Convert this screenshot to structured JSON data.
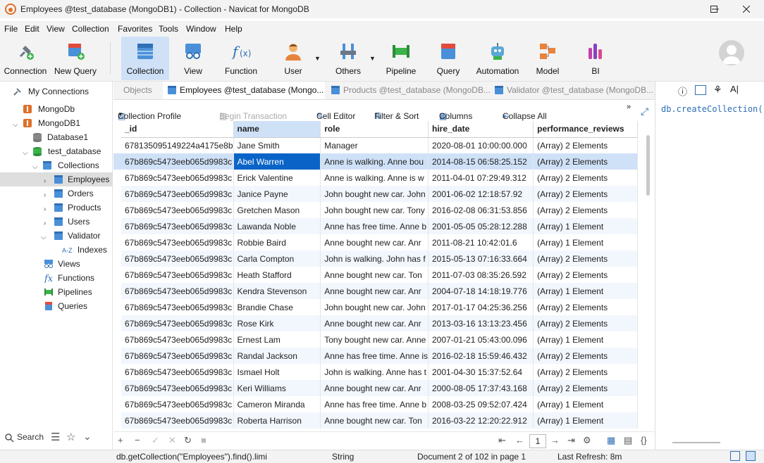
{
  "window": {
    "title": "Employees @test_database (MongoDB1) - Collection - Navicat for MongoDB",
    "min_icon": "minimize-icon",
    "max_icon": "maximize-icon",
    "close_icon": "close-icon"
  },
  "menu": [
    "File",
    "Edit",
    "View",
    "Collection",
    "Favorites",
    "Tools",
    "Window",
    "Help"
  ],
  "toolbar": {
    "connection": "Connection",
    "new_query": "New Query",
    "collection": "Collection",
    "view": "View",
    "function": "Function",
    "user": "User",
    "others": "Others",
    "pipeline": "Pipeline",
    "query": "Query",
    "automation": "Automation",
    "model": "Model",
    "bi": "BI"
  },
  "sidebar": {
    "header": "My Connections",
    "items": {
      "mongodb": "MongoDb",
      "mongodb1": "MongoDB1",
      "database1": "Database1",
      "test_database": "test_database",
      "collections": "Collections",
      "employees": "Employees",
      "orders": "Orders",
      "products": "Products",
      "users": "Users",
      "validator": "Validator",
      "indexes": "Indexes",
      "az": "A-Z",
      "views": "Views",
      "functions": "Functions",
      "pipelines": "Pipelines",
      "queries": "Queries"
    },
    "search": "Search"
  },
  "tabs": [
    "Objects",
    "Employees @test_database (Mongo...",
    "Products @test_database (MongoDB...",
    "Validator @test_database (MongoDB..."
  ],
  "content_toolbar": {
    "profile": "Collection Profile",
    "begin_tx": "Begin Transaction",
    "cell_editor": "Cell Editor",
    "filter_sort": "Filter & Sort",
    "columns": "Columns",
    "collapse_all": "Collapse All"
  },
  "table": {
    "columns": [
      "_id",
      "name",
      "role",
      "hire_date",
      "performance_reviews"
    ],
    "rows": [
      [
        "678135095149224a4175e8b",
        "Jane Smith",
        "Manager",
        "2020-08-01 10:00:00.000",
        "(Array) 2 Elements"
      ],
      [
        "67b869c5473eeb065d9983c",
        "Abel Warren",
        "Anne is walking. Anne bou",
        "2014-08-15 06:58:25.152",
        "(Array) 2 Elements"
      ],
      [
        "67b869c5473eeb065d9983c",
        "Erick Valentine",
        "Anne is walking. Anne is w",
        "2011-04-01 07:29:49.312",
        "(Array) 2 Elements"
      ],
      [
        "67b869c5473eeb065d9983c",
        "Janice Payne",
        "John bought new car. John",
        "2001-06-02 12:18:57.92",
        "(Array) 2 Elements"
      ],
      [
        "67b869c5473eeb065d9983c",
        "Gretchen Mason",
        "John bought new car. Tony",
        "2016-02-08 06:31:53.856",
        "(Array) 2 Elements"
      ],
      [
        "67b869c5473eeb065d9983c",
        "Lawanda Noble",
        "Anne has free time. Anne b",
        "2001-05-05 05:28:12.288",
        "(Array) 1 Element"
      ],
      [
        "67b869c5473eeb065d9983c",
        "Robbie Baird",
        "Anne bought new car. Anr",
        "2011-08-21 10:42:01.6",
        "(Array) 1 Element"
      ],
      [
        "67b869c5473eeb065d9983c",
        "Carla Compton",
        "John is walking. John has f",
        "2015-05-13 07:16:33.664",
        "(Array) 2 Elements"
      ],
      [
        "67b869c5473eeb065d9983c",
        "Heath Stafford",
        "Anne bought new car. Ton",
        "2011-07-03 08:35:26.592",
        "(Array) 2 Elements"
      ],
      [
        "67b869c5473eeb065d9983c",
        "Kendra Stevenson",
        "Anne bought new car. Anr",
        "2004-07-18 14:18:19.776",
        "(Array) 1 Element"
      ],
      [
        "67b869c5473eeb065d9983c",
        "Brandie Chase",
        "John bought new car. John",
        "2017-01-17 04:25:36.256",
        "(Array) 2 Elements"
      ],
      [
        "67b869c5473eeb065d9983c",
        "Rose Kirk",
        "Anne bought new car. Anr",
        "2013-03-16 13:13:23.456",
        "(Array) 2 Elements"
      ],
      [
        "67b869c5473eeb065d9983c",
        "Ernest Lam",
        "Tony bought new car. Anne",
        "2007-01-21 05:43:00.096",
        "(Array) 1 Element"
      ],
      [
        "67b869c5473eeb065d9983c",
        "Randal Jackson",
        "Anne has free time. Anne is",
        "2016-02-18 15:59:46.432",
        "(Array) 2 Elements"
      ],
      [
        "67b869c5473eeb065d9983c",
        "Ismael Holt",
        "John is walking. Anne has t",
        "2001-04-30 15:37:52.64",
        "(Array) 2 Elements"
      ],
      [
        "67b869c5473eeb065d9983c",
        "Keri Williams",
        "Anne bought new car. Anr",
        "2000-08-05 17:37:43.168",
        "(Array) 2 Elements"
      ],
      [
        "67b869c5473eeb065d9983c",
        "Cameron Miranda",
        "Anne has free time. Anne b",
        "2008-03-25 09:52:07.424",
        "(Array) 1 Element"
      ],
      [
        "67b869c5473eeb065d9983c",
        "Roberta Harrison",
        "Anne bought new car. Ton",
        "2016-03-22 12:20:22.912",
        "(Array) 1 Element"
      ]
    ]
  },
  "pager": {
    "page": "1"
  },
  "right_panel": {
    "code": "db.createCollection(\""
  },
  "status": {
    "query": "db.getCollection(\"Employees\").find().limi",
    "type": "String",
    "doc": "Document 2 of 102 in page 1",
    "refresh": "Last Refresh: 8m"
  },
  "colors": {
    "accent": "#0a64c8",
    "selection": "#cfe1f7"
  }
}
